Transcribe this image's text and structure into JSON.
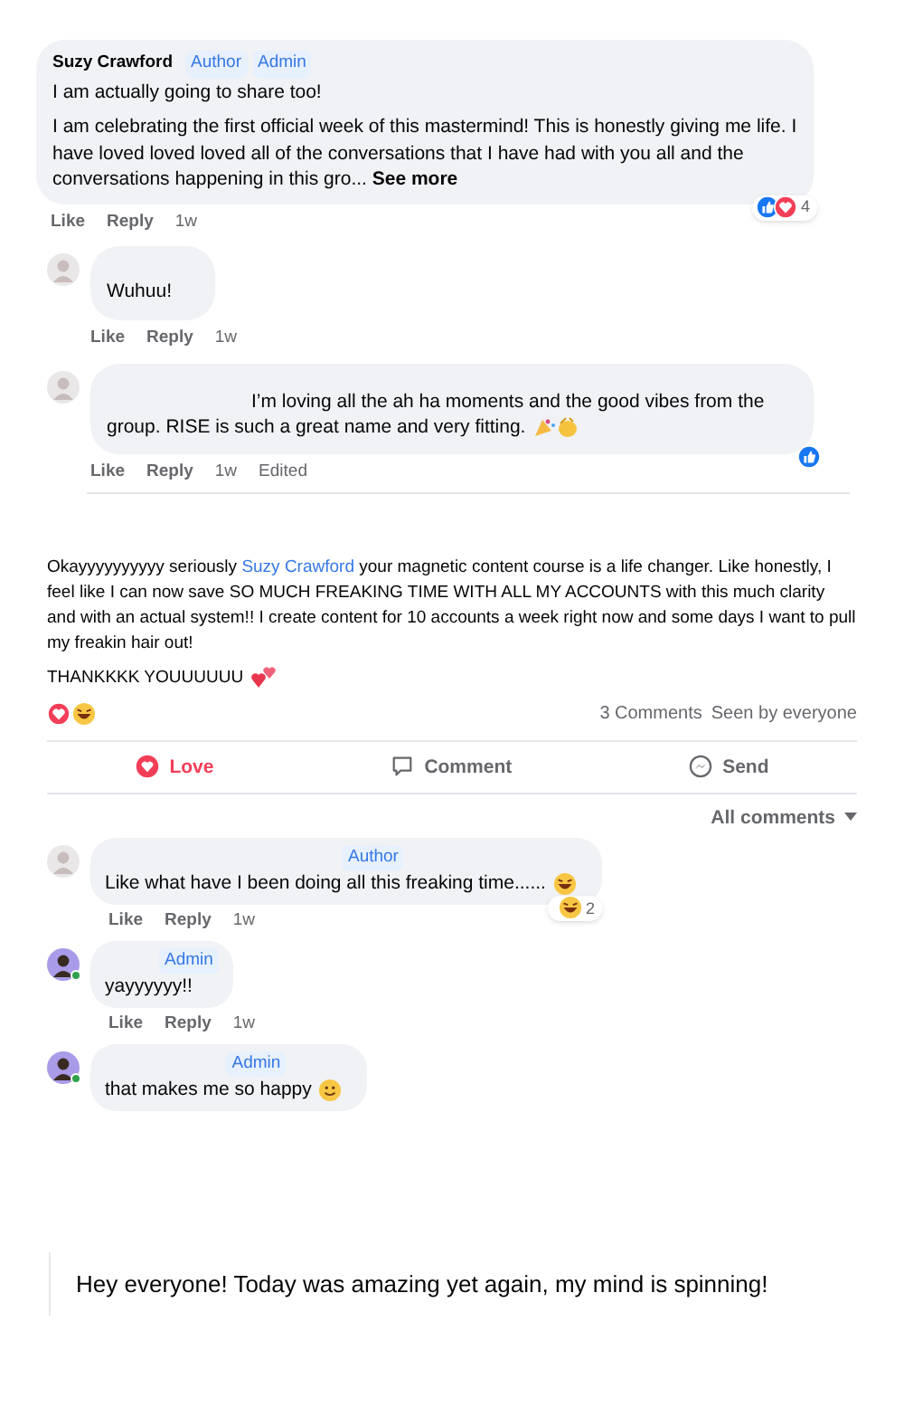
{
  "top_thread": {
    "comment": {
      "author": "Suzy Crawford",
      "badges": [
        "Author",
        "Admin"
      ],
      "lines": [
        "I am actually going to share too!",
        "I am celebrating the first official week of this mastermind! This is honestly giving me life. I have loved loved loved all of the conversations that I have had with you all and the conversations happening in this gro..."
      ],
      "see_more": "See more",
      "reaction_count": "4",
      "actions": [
        "Like",
        "Reply",
        "1w"
      ]
    },
    "replies": [
      {
        "text": "Wuhuu!",
        "indent": false,
        "actions": [
          "Like",
          "Reply",
          "1w"
        ]
      },
      {
        "text": "I’m loving all the ah ha moments and the good vibes from the group. RISE is such a great name and very fitting.",
        "indent": true,
        "emoji": {
          "kind": "party"
        },
        "liked": true,
        "actions": [
          "Like",
          "Reply",
          "1w",
          "Edited"
        ]
      }
    ]
  },
  "post": {
    "text_before": "Okayyyyyyyyyy seriously ",
    "mention": "Suzy Crawford",
    "text_after": " your magnetic content course is a life changer. Like honestly, I feel like I can now save SO MUCH FREAKING TIME WITH ALL MY ACCOUNTS with this much clarity and with an actual system!! I create content for 10 accounts a week right now and some days I want to pull my freakin hair out!",
    "closing": "THANKKKK YOUUUUUU",
    "closing_emoji": {
      "kind": "hearts"
    },
    "comment_count": "3 Comments",
    "seen": "Seen by everyone",
    "actions": [
      {
        "kind": "love",
        "label": "Love",
        "selected": true
      },
      {
        "kind": "comment",
        "label": "Comment",
        "selected": false
      },
      {
        "kind": "send",
        "label": "Send",
        "selected": false
      }
    ],
    "sort": "All comments",
    "comments": [
      {
        "badge": "Author",
        "text": "Like what have I been doing all this freaking time......",
        "emoji": {
          "kind": "laugh"
        },
        "online": false,
        "reaction_count": "2",
        "actions": [
          "Like",
          "Reply",
          "1w"
        ]
      },
      {
        "badge": "Admin",
        "text": "yayyyyyy!!",
        "online": true,
        "actions": [
          "Like",
          "Reply",
          "1w"
        ]
      },
      {
        "badge": "Admin",
        "text": "that makes me so happy",
        "emoji": {
          "kind": "smile"
        },
        "online": true
      }
    ]
  },
  "quote": {
    "text": "Hey everyone! Today was amazing yet again, my mind is spinning!"
  }
}
